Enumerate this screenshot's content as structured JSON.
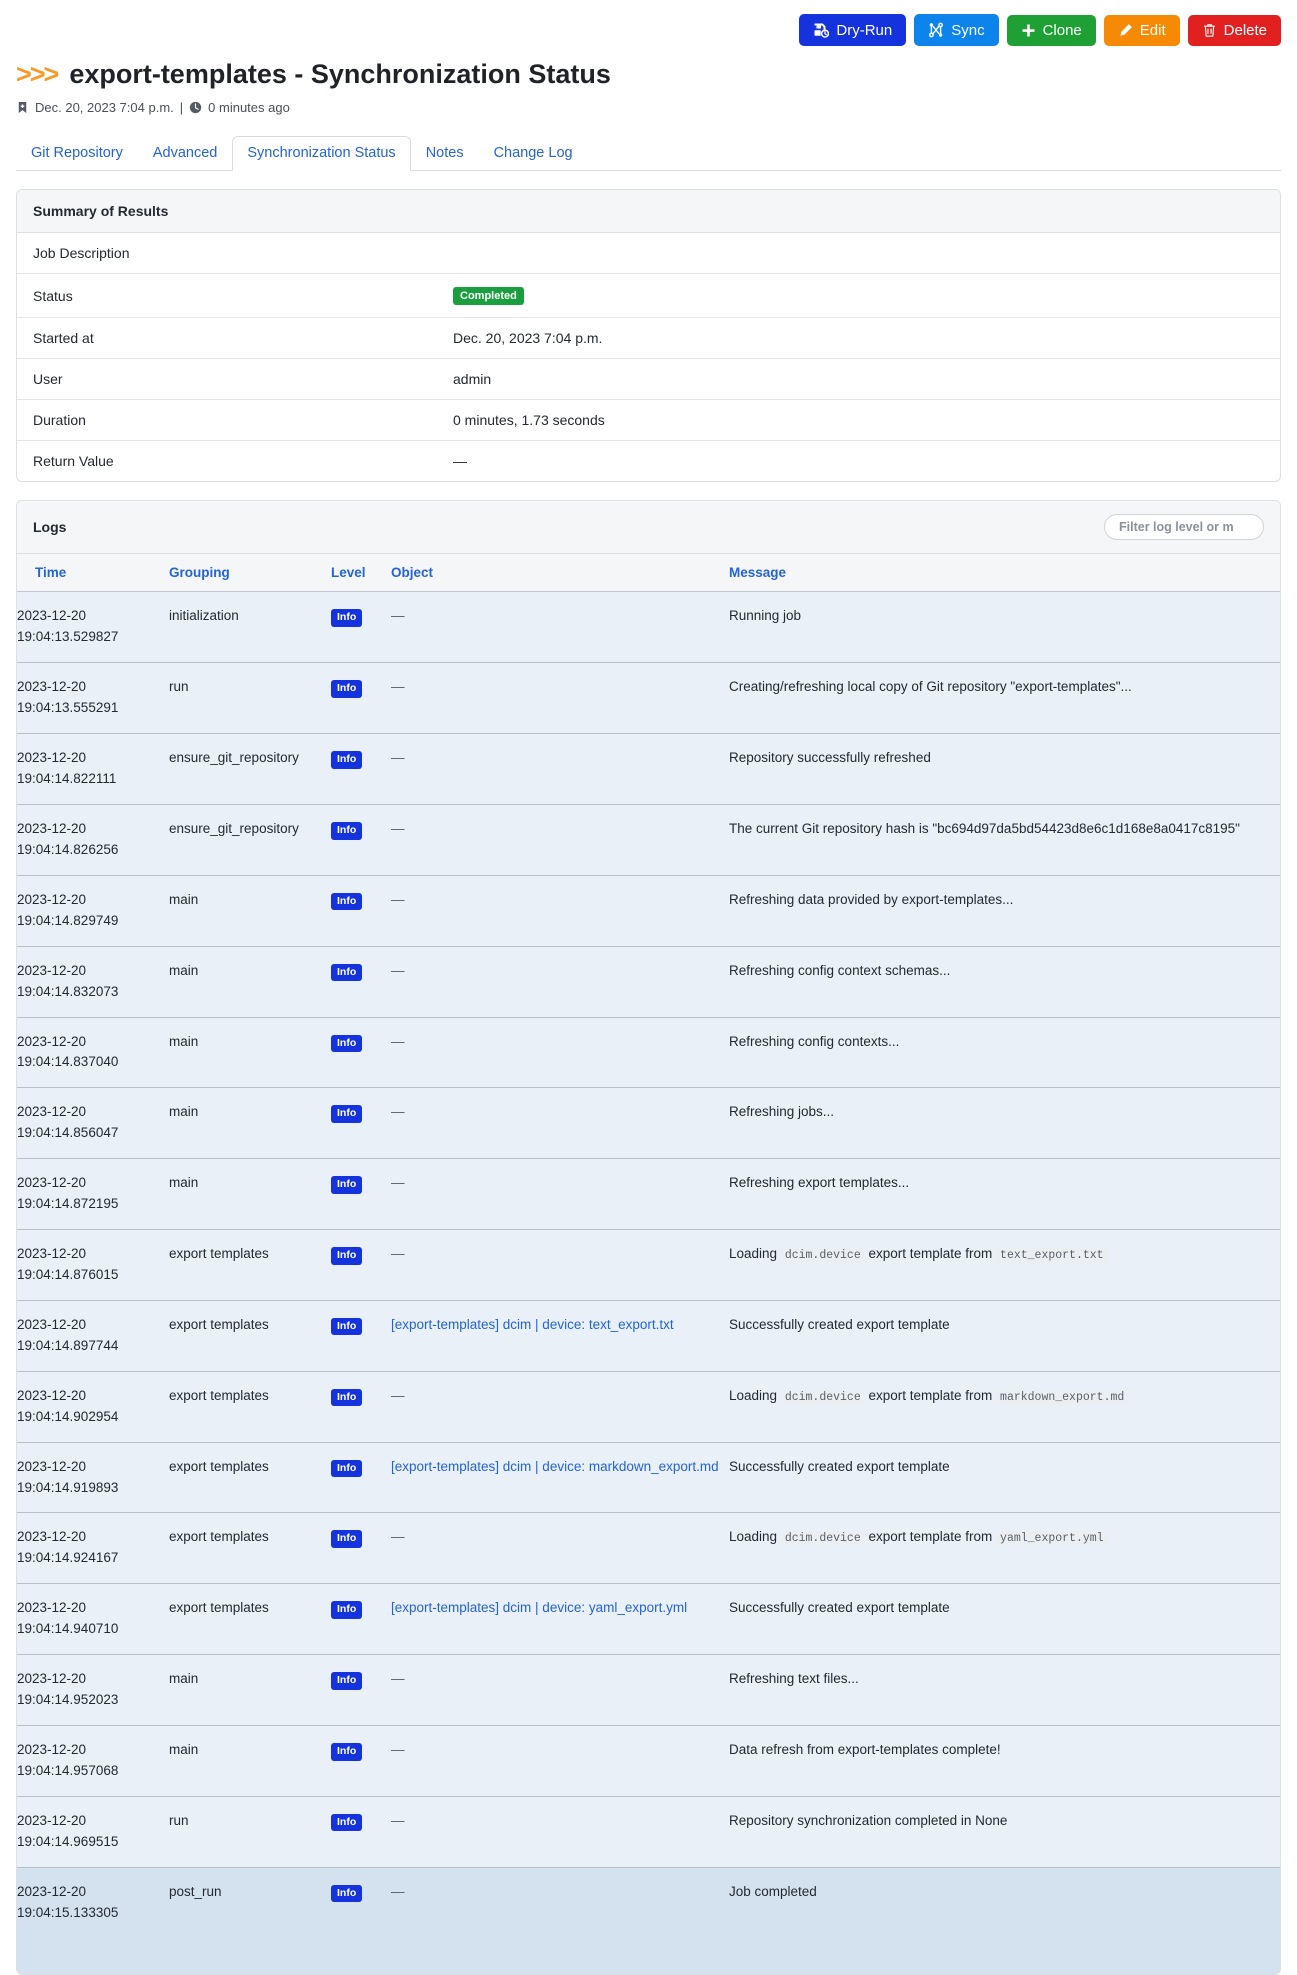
{
  "colors": {
    "dryrun": "#1433dd",
    "sync": "#0c84ec",
    "clone": "#1ea035",
    "edit": "#f68a04",
    "delete": "#e22020",
    "status_completed": "#1b9e3e",
    "level_info": "#1433dd",
    "link": "#2563d9",
    "accent": "#f59b2b"
  },
  "actions": [
    {
      "label": "Dry-Run",
      "icon": "dry-run-icon",
      "class": "btn-dryrun"
    },
    {
      "label": "Sync",
      "icon": "sync-icon",
      "class": "btn-sync"
    },
    {
      "label": "Clone",
      "icon": "plus-icon",
      "class": "btn-clone"
    },
    {
      "label": "Edit",
      "icon": "pencil-icon",
      "class": "btn-edit"
    },
    {
      "label": "Delete",
      "icon": "trash-icon",
      "class": "btn-delete"
    }
  ],
  "header": {
    "chevrons": ">>>",
    "title": "export-templates - Synchronization Status",
    "created_at": "Dec. 20, 2023 7:04 p.m.",
    "separator": "|",
    "relative_time": "0 minutes ago"
  },
  "tabs": [
    {
      "label": "Git Repository",
      "active": false
    },
    {
      "label": "Advanced",
      "active": false
    },
    {
      "label": "Synchronization Status",
      "active": true
    },
    {
      "label": "Notes",
      "active": false
    },
    {
      "label": "Change Log",
      "active": false
    }
  ],
  "summary": {
    "title": "Summary of Results",
    "rows": [
      {
        "key": "Job Description",
        "value": ""
      },
      {
        "key": "Status",
        "value": "Completed",
        "type": "badge"
      },
      {
        "key": "Started at",
        "value": "Dec. 20, 2023 7:04 p.m."
      },
      {
        "key": "User",
        "value": "admin"
      },
      {
        "key": "Duration",
        "value": "0 minutes, 1.73 seconds"
      },
      {
        "key": "Return Value",
        "value": "—"
      }
    ]
  },
  "logs": {
    "title": "Logs",
    "filter_placeholder": "Filter log level or m",
    "filter_value": "",
    "columns": [
      "Time",
      "Grouping",
      "Level",
      "Object",
      "Message"
    ],
    "rows": [
      {
        "date": "2023-12-20",
        "time": "19:04:13.529827",
        "grouping": "initialization",
        "level": "Info",
        "object": "—",
        "object_link": false,
        "message_parts": [
          {
            "t": "Running job"
          }
        ]
      },
      {
        "date": "2023-12-20",
        "time": "19:04:13.555291",
        "grouping": "run",
        "level": "Info",
        "object": "—",
        "object_link": false,
        "message_parts": [
          {
            "t": "Creating/refreshing local copy of Git repository \"export-templates\"..."
          }
        ]
      },
      {
        "date": "2023-12-20",
        "time": "19:04:14.822111",
        "grouping": "ensure_git_repository",
        "level": "Info",
        "object": "—",
        "object_link": false,
        "message_parts": [
          {
            "t": "Repository successfully refreshed"
          }
        ]
      },
      {
        "date": "2023-12-20",
        "time": "19:04:14.826256",
        "grouping": "ensure_git_repository",
        "level": "Info",
        "object": "—",
        "object_link": false,
        "message_parts": [
          {
            "t": "The current Git repository hash is \"bc694d97da5bd54423d8e6c1d168e8a0417c8195\""
          }
        ]
      },
      {
        "date": "2023-12-20",
        "time": "19:04:14.829749",
        "grouping": "main",
        "level": "Info",
        "object": "—",
        "object_link": false,
        "message_parts": [
          {
            "t": "Refreshing data provided by export-templates..."
          }
        ]
      },
      {
        "date": "2023-12-20",
        "time": "19:04:14.832073",
        "grouping": "main",
        "level": "Info",
        "object": "—",
        "object_link": false,
        "message_parts": [
          {
            "t": "Refreshing config context schemas..."
          }
        ]
      },
      {
        "date": "2023-12-20",
        "time": "19:04:14.837040",
        "grouping": "main",
        "level": "Info",
        "object": "—",
        "object_link": false,
        "message_parts": [
          {
            "t": "Refreshing config contexts..."
          }
        ]
      },
      {
        "date": "2023-12-20",
        "time": "19:04:14.856047",
        "grouping": "main",
        "level": "Info",
        "object": "—",
        "object_link": false,
        "message_parts": [
          {
            "t": "Refreshing jobs..."
          }
        ]
      },
      {
        "date": "2023-12-20",
        "time": "19:04:14.872195",
        "grouping": "main",
        "level": "Info",
        "object": "—",
        "object_link": false,
        "message_parts": [
          {
            "t": "Refreshing export templates..."
          }
        ]
      },
      {
        "date": "2023-12-20",
        "time": "19:04:14.876015",
        "grouping": "export templates",
        "level": "Info",
        "object": "—",
        "object_link": false,
        "message_parts": [
          {
            "t": "Loading "
          },
          {
            "t": "dcim.device",
            "code": true
          },
          {
            "t": " export template from "
          },
          {
            "t": "text_export.txt",
            "code": true
          }
        ]
      },
      {
        "date": "2023-12-20",
        "time": "19:04:14.897744",
        "grouping": "export templates",
        "level": "Info",
        "object": "[export-templates] dcim | device: text_export.txt",
        "object_link": true,
        "message_parts": [
          {
            "t": "Successfully created export template"
          }
        ]
      },
      {
        "date": "2023-12-20",
        "time": "19:04:14.902954",
        "grouping": "export templates",
        "level": "Info",
        "object": "—",
        "object_link": false,
        "message_parts": [
          {
            "t": "Loading "
          },
          {
            "t": "dcim.device",
            "code": true
          },
          {
            "t": " export template from "
          },
          {
            "t": "markdown_export.md",
            "code": true
          }
        ]
      },
      {
        "date": "2023-12-20",
        "time": "19:04:14.919893",
        "grouping": "export templates",
        "level": "Info",
        "object": "[export-templates] dcim | device: markdown_export.md",
        "object_link": true,
        "message_parts": [
          {
            "t": "Successfully created export template"
          }
        ]
      },
      {
        "date": "2023-12-20",
        "time": "19:04:14.924167",
        "grouping": "export templates",
        "level": "Info",
        "object": "—",
        "object_link": false,
        "message_parts": [
          {
            "t": "Loading "
          },
          {
            "t": "dcim.device",
            "code": true
          },
          {
            "t": " export template from "
          },
          {
            "t": "yaml_export.yml",
            "code": true
          }
        ]
      },
      {
        "date": "2023-12-20",
        "time": "19:04:14.940710",
        "grouping": "export templates",
        "level": "Info",
        "object": "[export-templates] dcim | device: yaml_export.yml",
        "object_link": true,
        "message_parts": [
          {
            "t": "Successfully created export template"
          }
        ]
      },
      {
        "date": "2023-12-20",
        "time": "19:04:14.952023",
        "grouping": "main",
        "level": "Info",
        "object": "—",
        "object_link": false,
        "message_parts": [
          {
            "t": "Refreshing text files..."
          }
        ]
      },
      {
        "date": "2023-12-20",
        "time": "19:04:14.957068",
        "grouping": "main",
        "level": "Info",
        "object": "—",
        "object_link": false,
        "message_parts": [
          {
            "t": "Data refresh from export-templates complete!"
          }
        ]
      },
      {
        "date": "2023-12-20",
        "time": "19:04:14.969515",
        "grouping": "run",
        "level": "Info",
        "object": "—",
        "object_link": false,
        "message_parts": [
          {
            "t": "Repository synchronization completed in None"
          }
        ]
      },
      {
        "date": "2023-12-20",
        "time": "19:04:15.133305",
        "grouping": "post_run",
        "level": "Info",
        "object": "—",
        "object_link": false,
        "highlight": true,
        "message_parts": [
          {
            "t": "Job completed"
          }
        ]
      }
    ]
  }
}
